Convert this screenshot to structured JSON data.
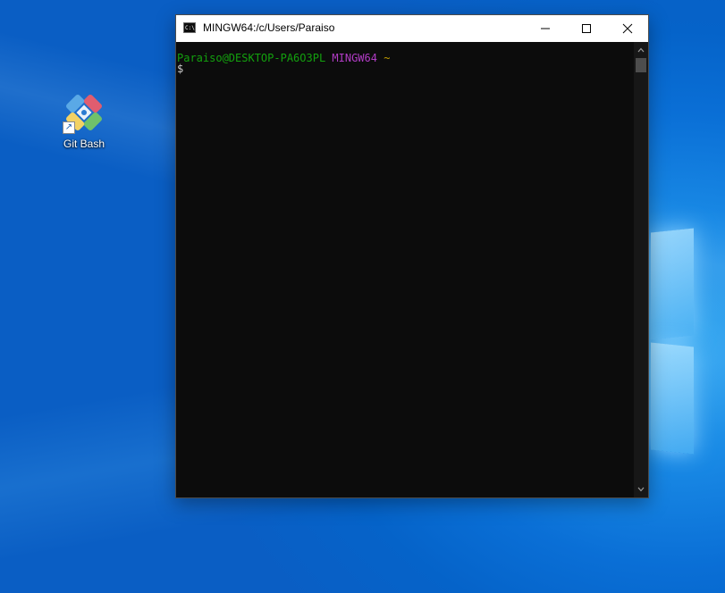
{
  "desktop": {
    "shortcuts": [
      {
        "label": "Git Bash",
        "icon": "git-bash-icon"
      }
    ]
  },
  "window": {
    "app_icon": "console-icon",
    "app_icon_text": "C:\\.",
    "title": "MINGW64:/c/Users/Paraiso",
    "controls": [
      "minimize-icon",
      "maximize-icon",
      "close-icon"
    ]
  },
  "terminal": {
    "prompt": {
      "user_host": "Paraiso@DESKTOP-PA6O3PL",
      "environment": "MINGW64",
      "path": "~",
      "symbol": "$"
    },
    "colors": {
      "user_host": "#13a10e",
      "environment": "#b23cc6",
      "path": "#c19c00",
      "background": "#0c0c0c"
    }
  },
  "colors": {
    "desktop_accent": "#0a6fd6",
    "title_bar": "#ffffff"
  }
}
